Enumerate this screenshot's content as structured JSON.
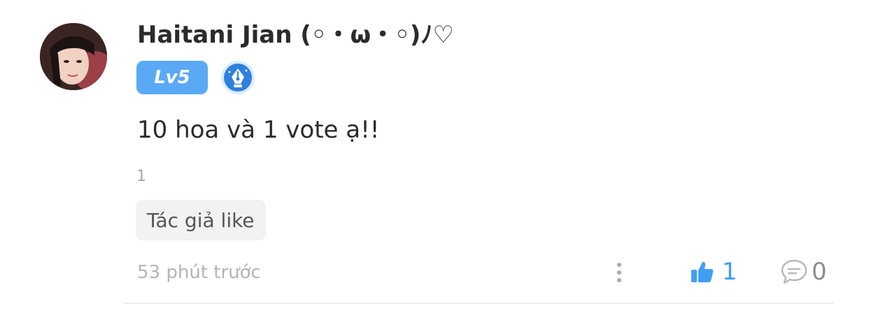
{
  "comment": {
    "avatar_icon": "user-avatar-photo",
    "username": "Haitani Jian (◦・ω・◦)ﾉ♡",
    "level_badge": "Lv5",
    "author_badge_icon": "pen-nib-icon",
    "text": "10 hoa và 1 vote ạ!!",
    "reply_count": "1",
    "author_like_tag": "Tác giả like",
    "timestamp": "53 phút trước",
    "more_icon": "more-vertical-icon",
    "likes": "1",
    "like_icon": "thumbs-up-icon",
    "replies": "0",
    "reply_icon": "comment-bubble-icon"
  },
  "colors": {
    "accent": "#3f9ef4",
    "level_badge_bg": "#5aa9f4",
    "muted_text": "#b4b4b4",
    "tag_bg": "#f2f2f2"
  }
}
